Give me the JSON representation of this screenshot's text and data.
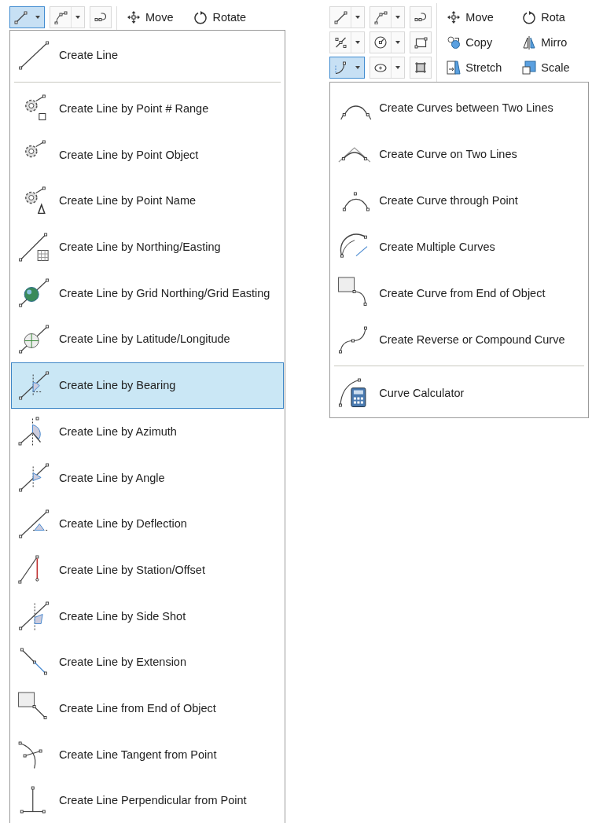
{
  "left_panel": {
    "toolbar": {
      "buttons": [
        {
          "kind": "split",
          "selected": true
        },
        {
          "kind": "split",
          "selected": false
        },
        {
          "kind": "single",
          "selected": false
        }
      ],
      "commands": [
        {
          "label": "Move"
        },
        {
          "label": "Rotate"
        }
      ]
    },
    "menu": {
      "sections": [
        [
          {
            "label": "Create Line",
            "selected": false
          }
        ],
        [
          {
            "label": "Create Line by Point # Range",
            "selected": false
          },
          {
            "label": "Create Line by Point Object",
            "selected": false
          },
          {
            "label": "Create Line by Point Name",
            "selected": false
          },
          {
            "label": "Create Line by Northing/Easting",
            "selected": false
          },
          {
            "label": "Create Line by Grid Northing/Grid Easting",
            "selected": false
          },
          {
            "label": "Create Line by Latitude/Longitude",
            "selected": false
          },
          {
            "label": "Create Line by Bearing",
            "selected": true
          },
          {
            "label": "Create Line by Azimuth",
            "selected": false
          },
          {
            "label": "Create Line by Angle",
            "selected": false
          },
          {
            "label": "Create Line by Deflection",
            "selected": false
          },
          {
            "label": "Create Line by Station/Offset",
            "selected": false
          },
          {
            "label": "Create Line by Side Shot",
            "selected": false
          },
          {
            "label": "Create Line by Extension",
            "selected": false
          },
          {
            "label": "Create Line from End of Object",
            "selected": false
          },
          {
            "label": "Create Line Tangent from Point",
            "selected": false
          },
          {
            "label": "Create Line Perpendicular from Point",
            "selected": false
          }
        ]
      ]
    }
  },
  "right_panel": {
    "toolbar": {
      "buttons": [
        {
          "kind": "split",
          "selected": false
        },
        {
          "kind": "split",
          "selected": false
        },
        {
          "kind": "single",
          "selected": false
        },
        {
          "kind": "split",
          "selected": false
        },
        {
          "kind": "split",
          "selected": false
        },
        {
          "kind": "single",
          "selected": false
        },
        {
          "kind": "split",
          "selected": true
        },
        {
          "kind": "split",
          "selected": false
        },
        {
          "kind": "single",
          "selected": false
        }
      ],
      "commands": [
        {
          "label": "Move"
        },
        {
          "label": "Rota"
        },
        {
          "label": "Copy"
        },
        {
          "label": "Mirro"
        },
        {
          "label": "Stretch"
        },
        {
          "label": "Scale"
        }
      ]
    },
    "menu": {
      "sections": [
        [
          {
            "label": "Create Curves between Two Lines",
            "selected": false
          },
          {
            "label": "Create Curve on Two Lines",
            "selected": false
          },
          {
            "label": "Create Curve through Point",
            "selected": false
          },
          {
            "label": "Create Multiple Curves",
            "selected": false
          },
          {
            "label": "Create Curve from End of Object",
            "selected": false
          },
          {
            "label": "Create Reverse or Compound Curve",
            "selected": false
          }
        ],
        [
          {
            "label": "Curve Calculator",
            "selected": false
          }
        ]
      ]
    }
  }
}
